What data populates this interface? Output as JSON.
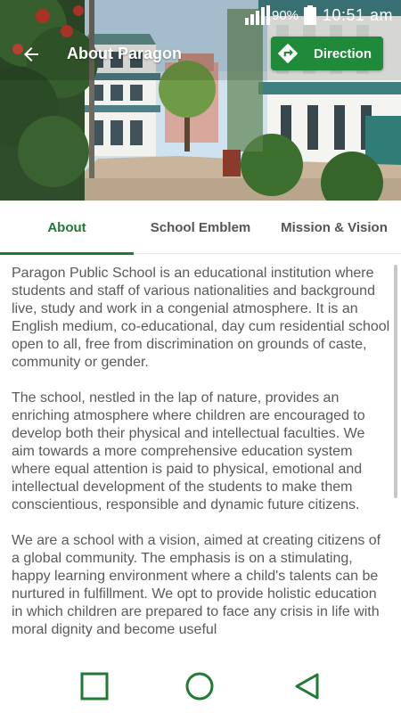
{
  "status_bar": {
    "battery_percent": "90%",
    "time": "10:51 am"
  },
  "app_bar": {
    "title": "About Paragon",
    "back_icon": "arrow-back-icon",
    "direction_label": "Direction",
    "direction_icon": "directions-icon"
  },
  "tabs": [
    {
      "label": "About",
      "active": true
    },
    {
      "label": "School Emblem",
      "active": false
    },
    {
      "label": "Mission & Vision",
      "active": false
    }
  ],
  "content": {
    "paragraphs": [
      "Paragon Public School is an educational institution where students and staff of various nationalities and background live, study and work in a congenial atmosphere. It is an English medium, co-educational, day cum residential school open to all, free from discrimination on grounds of caste, community or gender.",
      "The school, nestled in the lap of nature, provides an enriching atmosphere where children are encouraged to develop both their physical and intellectual faculties. We aim towards a more comprehensive education system where equal attention is paid to physical, emotional and intellectual development of the students to make them conscientious, responsible and dynamic future citizens.",
      "We are a school with a vision, aimed at creating citizens of a global community. The emphasis is on a stimulating, happy learning environment where a child's talents can be nurtured in fulfillment. We opt to provide holistic education in which children are prepared to face any crisis in life with moral dignity and  become useful"
    ]
  },
  "nav_bar": {
    "recents_icon": "square-recents-icon",
    "home_icon": "circle-home-icon",
    "back_icon": "triangle-back-icon"
  },
  "colors": {
    "accent": "#1f7a34",
    "direction_button": "#1f8a3a",
    "body_text": "#5a5a5a"
  }
}
